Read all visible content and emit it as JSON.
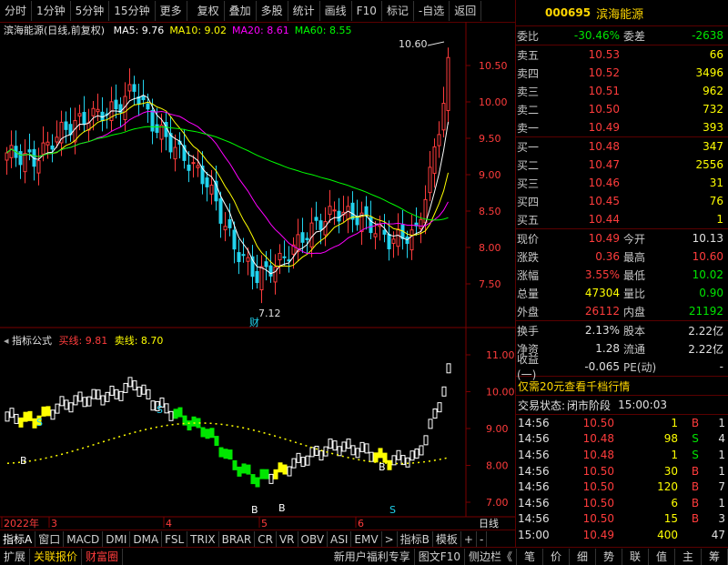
{
  "toolbar": {
    "items": [
      "分时",
      "1分钟",
      "5分钟",
      "15分钟",
      "更多",
      "复权",
      "叠加",
      "多股",
      "统计",
      "画线",
      "F10",
      "标记",
      "-自选",
      "返回"
    ]
  },
  "main_chart": {
    "title": "滨海能源(日线,前复权)",
    "ma": [
      {
        "label": "MA5: 9.76",
        "color": "#ffffff"
      },
      {
        "label": "MA10: 9.02",
        "color": "#ffff00"
      },
      {
        "label": "MA20: 8.61",
        "color": "#ff00ff"
      },
      {
        "label": "MA60: 8.55",
        "color": "#00ff00"
      }
    ],
    "price_axis": [
      "10.50",
      "10.00",
      "9.50",
      "9.00",
      "8.50",
      "8.00",
      "7.50"
    ],
    "high_label": "10.60",
    "low_label": "7.12",
    "fin_label": "财"
  },
  "indicator": {
    "name": "指标公式",
    "buy_label": "买线: 9.81",
    "sell_label": "卖线: 8.70",
    "axis": [
      "11.00",
      "10.00",
      "9.00",
      "8.00",
      "7.00"
    ],
    "markers": [
      "S",
      "S",
      "B",
      "B",
      "B",
      "S",
      "B"
    ]
  },
  "date_axis": {
    "labels": [
      "2022年",
      "3",
      "4",
      "5",
      "6"
    ],
    "period": "日线"
  },
  "func_tabs": [
    "指标A",
    "窗口",
    "MACD",
    "DMI",
    "DMA",
    "FSL",
    "TRIX",
    "BRAR",
    "CR",
    "VR",
    "OBV",
    "ASI",
    "EMV",
    ">",
    "指标B",
    "模板",
    "+",
    "-"
  ],
  "bottom": [
    "扩展",
    "关联报价",
    "财富圈"
  ],
  "bottom_right": {
    "promo": "新用户福利专享",
    "f10": "图文F10",
    "sidebar": "侧边栏《"
  },
  "right_tabs": [
    "笔",
    "价",
    "细",
    "势",
    "联",
    "值",
    "主",
    "筹"
  ],
  "quote": {
    "code": "000695",
    "name": "滨海能源",
    "weibi_label": "委比",
    "weibi": "-30.46%",
    "weicha_label": "委差",
    "weicha": "-2638",
    "asks": [
      {
        "label": "卖五",
        "price": "10.53",
        "vol": "66"
      },
      {
        "label": "卖四",
        "price": "10.52",
        "vol": "3496"
      },
      {
        "label": "卖三",
        "price": "10.51",
        "vol": "962"
      },
      {
        "label": "卖二",
        "price": "10.50",
        "vol": "732"
      },
      {
        "label": "卖一",
        "price": "10.49",
        "vol": "393"
      }
    ],
    "bids": [
      {
        "label": "买一",
        "price": "10.48",
        "vol": "347"
      },
      {
        "label": "买二",
        "price": "10.47",
        "vol": "2556"
      },
      {
        "label": "买三",
        "price": "10.46",
        "vol": "31"
      },
      {
        "label": "买四",
        "price": "10.45",
        "vol": "76"
      },
      {
        "label": "买五",
        "price": "10.44",
        "vol": "1"
      }
    ],
    "stats": [
      {
        "l1": "现价",
        "v1": "10.49",
        "c1": "red",
        "l2": "今开",
        "v2": "10.13",
        "c2": "wh"
      },
      {
        "l1": "涨跌",
        "v1": "0.36",
        "c1": "red",
        "l2": "最高",
        "v2": "10.60",
        "c2": "red"
      },
      {
        "l1": "涨幅",
        "v1": "3.55%",
        "c1": "red",
        "l2": "最低",
        "v2": "10.02",
        "c2": "green"
      },
      {
        "l1": "总量",
        "v1": "47304",
        "c1": "yel",
        "l2": "量比",
        "v2": "0.90",
        "c2": "green"
      },
      {
        "l1": "外盘",
        "v1": "26112",
        "c1": "red",
        "l2": "内盘",
        "v2": "21192",
        "c2": "green"
      }
    ],
    "stats2": [
      {
        "l1": "换手",
        "v1": "2.13%",
        "l2": "股本",
        "v2": "2.22亿"
      },
      {
        "l1": "净资",
        "v1": "1.28",
        "l2": "流通",
        "v2": "2.22亿"
      },
      {
        "l1": "收益(一)",
        "v1": "-0.065",
        "l2": "PE(动)",
        "v2": "-"
      }
    ],
    "promo": "仅需20元查看千档行情",
    "status_label": "交易状态:",
    "status": "闭市阶段",
    "status_time": "15:00:03",
    "trades": [
      {
        "time": "14:56",
        "price": "10.50",
        "vol": "1",
        "dir": "B",
        "n": "1"
      },
      {
        "time": "14:56",
        "price": "10.48",
        "vol": "98",
        "dir": "S",
        "n": "4"
      },
      {
        "time": "14:56",
        "price": "10.48",
        "vol": "1",
        "dir": "S",
        "n": "1"
      },
      {
        "time": "14:56",
        "price": "10.50",
        "vol": "30",
        "dir": "B",
        "n": "1"
      },
      {
        "time": "14:56",
        "price": "10.50",
        "vol": "120",
        "dir": "B",
        "n": "7"
      },
      {
        "time": "14:56",
        "price": "10.50",
        "vol": "6",
        "dir": "B",
        "n": "1"
      },
      {
        "time": "14:56",
        "price": "10.50",
        "vol": "15",
        "dir": "B",
        "n": "3"
      },
      {
        "time": "15:00",
        "price": "10.49",
        "vol": "400",
        "dir": "",
        "n": "47"
      }
    ]
  }
}
